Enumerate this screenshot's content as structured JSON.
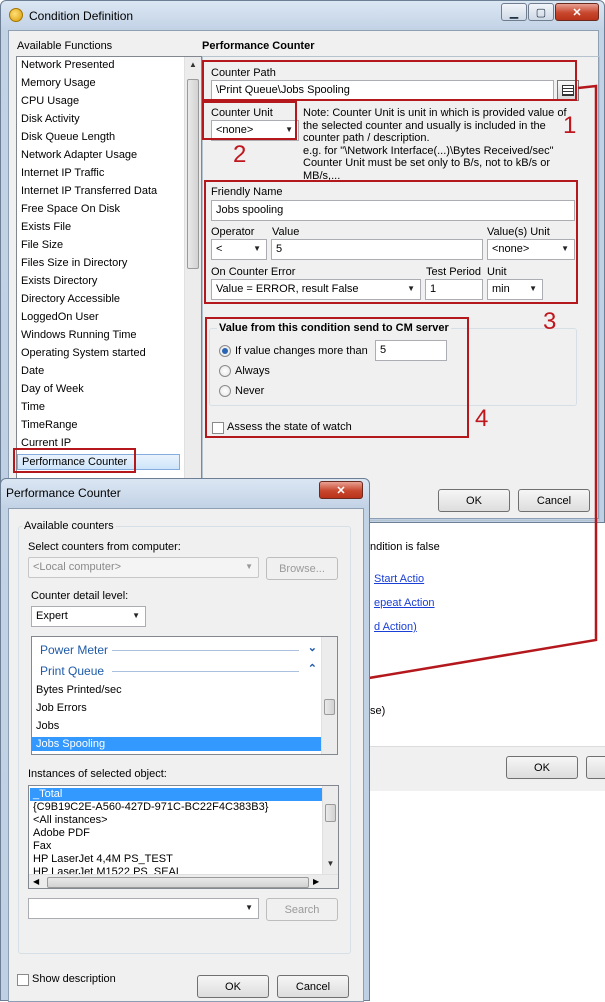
{
  "condition_window": {
    "title": "Condition Definition",
    "functions_header": "Available Functions",
    "functions": [
      "Network Presented",
      "Memory Usage",
      "CPU Usage",
      "Disk Activity",
      "Disk Queue Length",
      "Network Adapter Usage",
      "Internet IP Traffic",
      "Internet IP Transferred Data",
      "Free Space On Disk",
      "Exists File",
      "File Size",
      "Files Size in Directory",
      "Exists Directory",
      "Directory Accessible",
      "LoggedOn User",
      "Windows Running Time",
      "Operating System started",
      "Date",
      "Day of Week",
      "Time",
      "TimeRange",
      "Current IP",
      "Performance Counter"
    ],
    "selected_function": "Performance Counter",
    "panel_title": "Performance Counter",
    "counter_path_label": "Counter Path",
    "counter_path_value": "\\Print Queue\\Jobs Spooling",
    "counter_unit_label": "Counter Unit",
    "counter_unit_value": "<none>",
    "note_text": "Note: Counter Unit is unit in which is provided value of the selected counter and usually is included in the counter path / description.\ne.g. for \"\\Network Interface(...)\\Bytes Received/sec\" Counter Unit must be set only to B/s, not to kB/s or MB/s,...",
    "friendly_name_label": "Friendly Name",
    "friendly_name_value": "Jobs spooling",
    "operator_label": "Operator",
    "operator_value": "<",
    "value_label": "Value",
    "value_value": "5",
    "value_unit_label": "Value(s) Unit",
    "value_unit_value": "<none>",
    "on_error_label": "On Counter Error",
    "on_error_value": "Value = ERROR, result False",
    "test_period_label": "Test Period",
    "test_period_value": "1",
    "unit_label": "Unit",
    "unit_value": "min",
    "send_group_title": "Value from this condition send to CM server",
    "radio_changes": "If value changes more than",
    "radio_changes_value": "5",
    "radio_always": "Always",
    "radio_never": "Never",
    "assess_label": "Assess the state of watch",
    "ok": "OK",
    "cancel": "Cancel"
  },
  "background": {
    "condition_false": "ndition is false",
    "link1": "Start Actio",
    "link2": "epeat Action",
    "link3": "d Action)",
    "se_text": "se)",
    "ok": "OK"
  },
  "annotations": [
    "1",
    "2",
    "3",
    "4"
  ],
  "counter_window": {
    "title": "Performance Counter",
    "available_counters": "Available counters",
    "select_computer_label": "Select counters from computer:",
    "computer_value": "<Local computer>",
    "browse": "Browse...",
    "detail_level_label": "Counter detail level:",
    "detail_level_value": "Expert",
    "categories": [
      {
        "name": "Power Meter",
        "chev": "⌄"
      },
      {
        "name": "Print Queue",
        "chev": "⌃"
      }
    ],
    "counters": [
      "Bytes Printed/sec",
      "Job Errors",
      "Jobs",
      "Jobs Spooling"
    ],
    "selected_counter": "Jobs Spooling",
    "instances_label": "Instances of selected object:",
    "instances": [
      "_Total",
      "{C9B19C2E-A560-427D-971C-BC22F4C383B3}",
      "<All instances>",
      "Adobe PDF",
      "Fax",
      "HP LaserJet 4,4M PS_TEST",
      "HP LaserJet M1522 PS_SEAL"
    ],
    "search": "Search",
    "show_description": "Show description",
    "ok": "OK",
    "cancel": "Cancel"
  },
  "colors": {
    "annotation_red": "#b4181d",
    "selection_blue": "#3399ff",
    "category_blue": "#1e5aa8"
  }
}
